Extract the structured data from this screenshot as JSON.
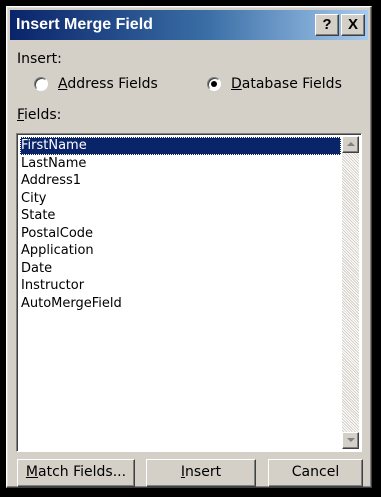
{
  "window": {
    "title": "Insert Merge Field",
    "help_label": "?",
    "close_label": "X"
  },
  "insert": {
    "label": "Insert:",
    "options": [
      {
        "mnemonic": "A",
        "rest": "ddress Fields",
        "checked": false
      },
      {
        "mnemonic": "D",
        "rest": "atabase Fields",
        "checked": true
      }
    ]
  },
  "fields": {
    "label_mnemonic": "F",
    "label_rest": "ields:",
    "items": [
      "FirstName",
      "LastName",
      "Address1",
      "City",
      "State",
      "PostalCode",
      "Application",
      "Date",
      "Instructor",
      "AutoMergeField"
    ],
    "selected": "FirstName"
  },
  "buttons": {
    "match_mnemonic": "M",
    "match_rest": "atch Fields...",
    "insert_mnemonic": "I",
    "insert_rest": "nsert",
    "cancel": "Cancel"
  }
}
